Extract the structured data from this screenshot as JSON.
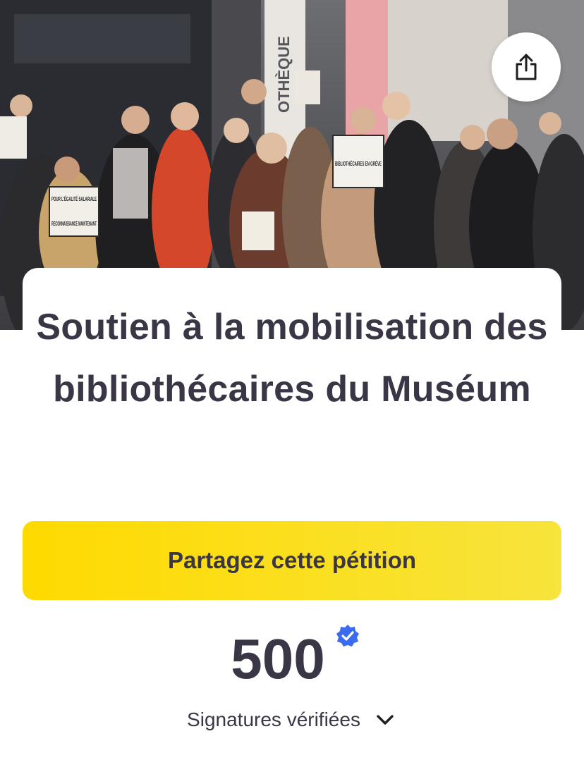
{
  "hero": {
    "image_name": "protest-photo",
    "signs": [
      {
        "text": "POUR L'ÉGALITÉ SALARIALE"
      },
      {
        "text": "RECONNAISSANCE MAINTENANT"
      },
      {
        "text": "BIBLIOTHÉCAIRES EN GRÈVE"
      }
    ],
    "building_text": "OTHÈQUE"
  },
  "share_icon": "share-icon",
  "petition": {
    "title": "Soutien à la mobilisation des bibliothécaires du Muséum",
    "cta_label": "Partagez cette pétition",
    "signature_count": "500",
    "signature_label": "Signatures vérifiées",
    "verified_icon": "verified-badge-icon",
    "expand_icon": "chevron-down-icon"
  },
  "colors": {
    "cta_start": "#ffda00",
    "cta_end": "#f7e43c",
    "text": "#3a3645",
    "verified": "#3b6cf0"
  }
}
